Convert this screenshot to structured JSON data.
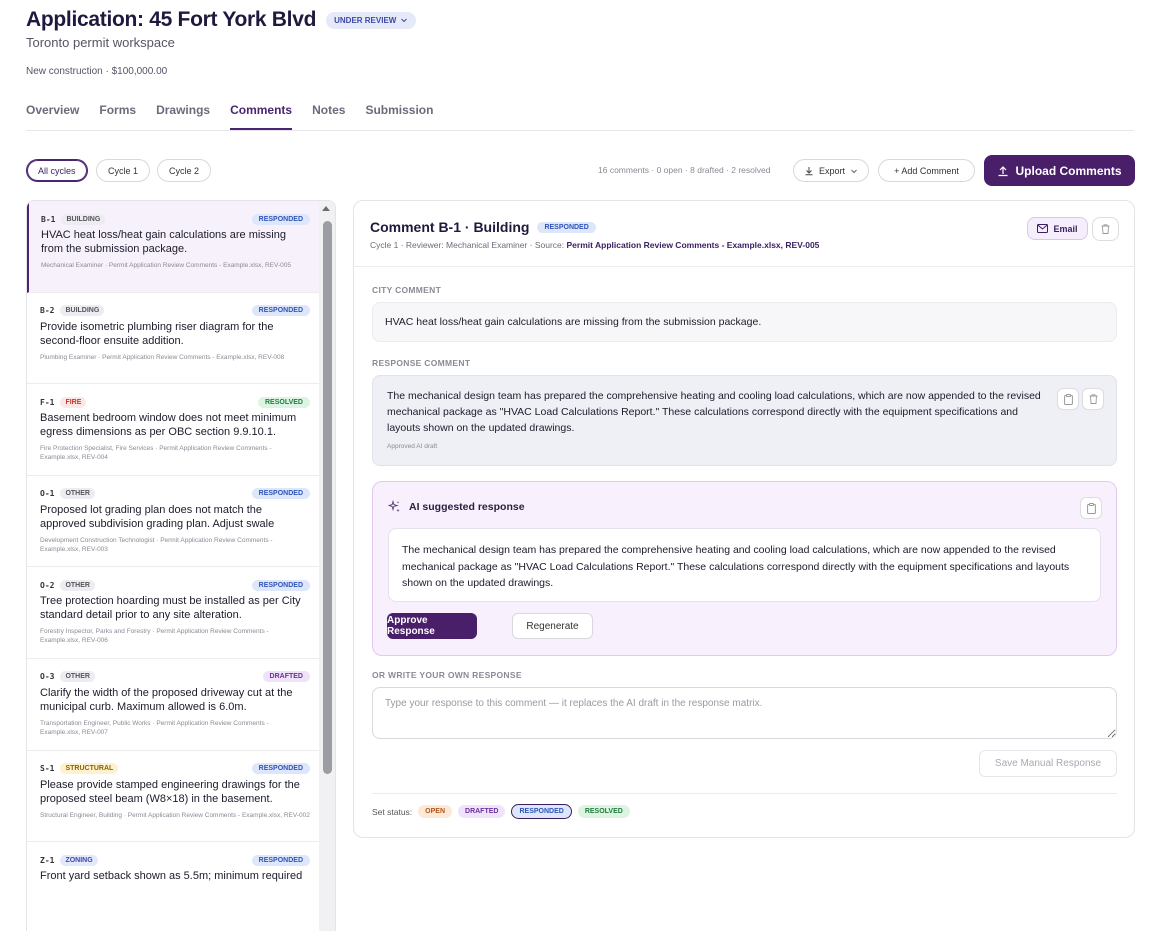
{
  "header": {
    "title": "Application: 45 Fort York Blvd",
    "status": "UNDER REVIEW",
    "subtitle": "Toronto permit workspace",
    "meta": "New construction · $100,000.00"
  },
  "tabs": [
    {
      "label": "Overview"
    },
    {
      "label": "Forms"
    },
    {
      "label": "Drawings"
    },
    {
      "label": "Comments"
    },
    {
      "label": "Notes"
    },
    {
      "label": "Submission"
    }
  ],
  "filters": {
    "cycles": [
      "All cycles",
      "Cycle 1",
      "Cycle 2"
    ],
    "summary": "16 comments · 0 open · 8 drafted · 2 resolved",
    "export_label": "Export",
    "add_label": "+ Add Comment",
    "upload_label": "Upload Comments"
  },
  "comments": [
    {
      "code": "B-1",
      "tag": "BUILDING",
      "state": "RESPONDED",
      "text": "HVAC heat loss/heat gain calculations are missing from the submission package.",
      "source": "Mechanical Examiner · Permit Application Review Comments - Example.xlsx, REV-005"
    },
    {
      "code": "B-2",
      "tag": "BUILDING",
      "state": "RESPONDED",
      "text": "Provide isometric plumbing riser diagram for the second-floor ensuite addition.",
      "source": "Plumbing Examiner · Permit Application Review Comments - Example.xlsx, REV-008"
    },
    {
      "code": "F-1",
      "tag": "FIRE",
      "state": "RESOLVED",
      "text": "Basement bedroom window does not meet minimum egress dimensions as per OBC section 9.9.10.1.",
      "source": "Fire Protection Specialist, Fire Services · Permit Application Review Comments - Example.xlsx, REV-004"
    },
    {
      "code": "O-1",
      "tag": "OTHER",
      "state": "RESPONDED",
      "text": "Proposed lot grading plan does not match the approved subdivision grading plan. Adjust swale elevations alon...",
      "source": "Development Construction Technologist · Permit Application Review Comments - Example.xlsx, REV-003"
    },
    {
      "code": "O-2",
      "tag": "OTHER",
      "state": "RESPONDED",
      "text": "Tree protection hoarding must be installed as per City standard detail prior to any site alteration.",
      "source": "Forestry Inspector, Parks and Forestry · Permit Application Review Comments - Example.xlsx, REV-006"
    },
    {
      "code": "O-3",
      "tag": "OTHER",
      "state": "DRAFTED",
      "text": "Clarify the width of the proposed driveway cut at the municipal curb. Maximum allowed is 6.0m.",
      "source": "Transportation Engineer, Public Works · Permit Application Review Comments - Example.xlsx, REV-007"
    },
    {
      "code": "S-1",
      "tag": "STRUCTURAL",
      "state": "RESPONDED",
      "text": "Please provide stamped engineering drawings for the proposed steel beam (W8×18) in the basement.",
      "source": "Structural Engineer, Building · Permit Application Review Comments - Example.xlsx, REV-002"
    },
    {
      "code": "Z-1",
      "tag": "ZONING",
      "state": "RESPONDED",
      "text": "Front yard setback shown as 5.5m; minimum required",
      "source": ""
    }
  ],
  "detail": {
    "title": "Comment B-1 · Building",
    "state": "RESPONDED",
    "meta_prefix": "Cycle 1 · Reviewer: Mechanical Examiner · Source: ",
    "meta_source": "Permit Application Review Comments - Example.xlsx, REV-005",
    "email_label": "Email",
    "city_label": "CITY COMMENT",
    "city_text": "HVAC heat loss/heat gain calculations are missing from the submission package.",
    "response_label": "RESPONSE COMMENT",
    "response_text": "The mechanical design team has prepared the comprehensive heating and cooling load calculations, which are now appended to the revised mechanical package as \"HVAC Load Calculations Report.\" These calculations correspond directly with the equipment specifications and layouts shown on the updated drawings.",
    "response_note": "Approved AI draft",
    "ai_label": "AI suggested response",
    "ai_text": "The mechanical design team has prepared the comprehensive heating and cooling load calculations, which are now appended to the revised mechanical package as \"HVAC Load Calculations Report.\" These calculations correspond directly with the equipment specifications and layouts shown on the updated drawings.",
    "approve_label": "Approve Response",
    "regenerate_label": "Regenerate",
    "own_label": "OR WRITE YOUR OWN RESPONSE",
    "own_placeholder": "Type your response to this comment — it replaces the AI draft in the response matrix.",
    "save_label": "Save Manual Response",
    "status_label": "Set status:",
    "statuses": [
      "OPEN",
      "DRAFTED",
      "RESPONDED",
      "RESOLVED"
    ]
  }
}
